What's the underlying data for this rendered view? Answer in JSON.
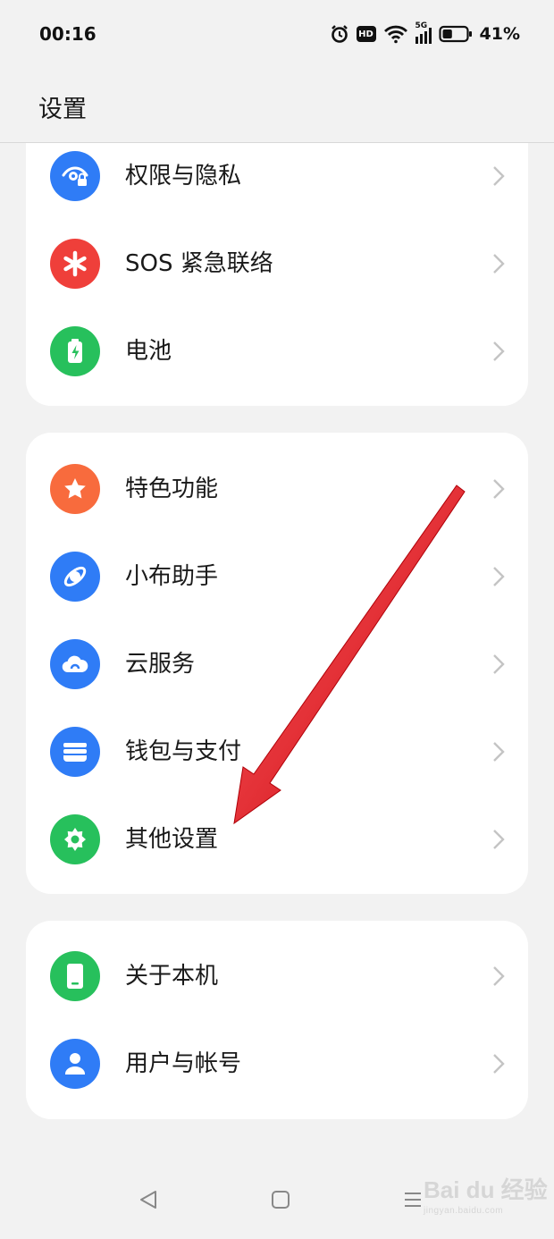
{
  "status_bar": {
    "time": "00:16",
    "battery_percent": "41%",
    "network": "5G",
    "hd_badge": "HD",
    "battery_level": 0.41
  },
  "header": {
    "title": "设置"
  },
  "groups": [
    {
      "items": [
        {
          "label": "权限与隐私",
          "icon": "privacy-eye-lock-icon",
          "color": "#2f7cf6"
        },
        {
          "label": "SOS 紧急联络",
          "icon": "sos-asterisk-icon",
          "color": "#ef3f3a"
        },
        {
          "label": "电池",
          "icon": "battery-icon",
          "color": "#27c05c"
        }
      ]
    },
    {
      "items": [
        {
          "label": "特色功能",
          "icon": "star-icon",
          "color": "#f86b3d"
        },
        {
          "label": "小布助手",
          "icon": "assistant-orbit-icon",
          "color": "#2f7cf6"
        },
        {
          "label": "云服务",
          "icon": "cloud-icon",
          "color": "#2f7cf6"
        },
        {
          "label": "钱包与支付",
          "icon": "wallet-icon",
          "color": "#2f7cf6"
        },
        {
          "label": "其他设置",
          "icon": "gear-icon",
          "color": "#27c05c"
        }
      ]
    },
    {
      "items": [
        {
          "label": "关于本机",
          "icon": "phone-icon",
          "color": "#27c05c"
        },
        {
          "label": "用户与帐号",
          "icon": "user-icon",
          "color": "#2f7cf6"
        }
      ]
    }
  ],
  "annotation": {
    "arrow_color": "#e8141b",
    "target": "其他设置"
  },
  "watermark": {
    "text": "Bai du 经验",
    "sub": "jingyan.baidu.com"
  }
}
